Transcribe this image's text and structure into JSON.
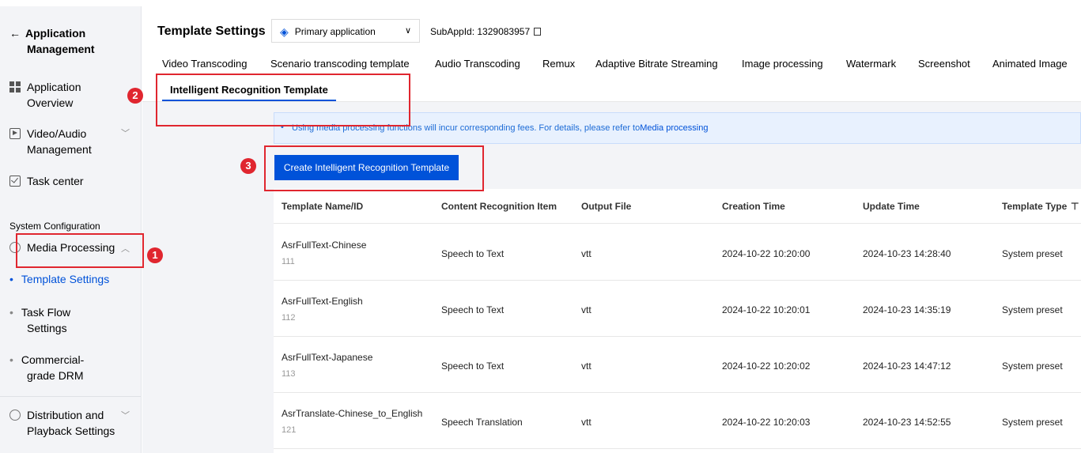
{
  "sidebar": {
    "back_label_line1": "Application",
    "back_label_line2": "Management",
    "items": [
      {
        "label1": "Application",
        "label2": "Overview",
        "icon": "grid-icon"
      },
      {
        "label1": "Video/Audio",
        "label2": "Management",
        "icon": "play-square-icon"
      },
      {
        "label1": "Task center",
        "label2": "",
        "icon": "checkbox-icon"
      }
    ],
    "section_title": "System Configuration",
    "media_processing": "Media Processing",
    "sub_items": [
      {
        "label1": "Template Settings",
        "label2": ""
      },
      {
        "label1": "Task Flow",
        "label2": "Settings"
      },
      {
        "label1": "Commercial-",
        "label2": "grade DRM"
      }
    ],
    "distribution_line1": "Distribution and",
    "distribution_line2": "Playback Settings"
  },
  "header": {
    "title": "Template Settings",
    "app_select_value": "Primary application",
    "subapp": "SubAppId: 1329083957"
  },
  "tabs": [
    "Video Transcoding",
    "Scenario transcoding template",
    "Audio Transcoding",
    "Remux",
    "Adaptive Bitrate Streaming",
    "Image processing",
    "Watermark",
    "Screenshot",
    "Animated Image"
  ],
  "active_tab": "Intelligent Recognition Template",
  "notice": {
    "text": "Using media processing functions will incur corresponding fees. For details, please refer to",
    "link": "Media processing"
  },
  "create_button": "Create Intelligent Recognition Template",
  "table": {
    "columns": [
      "Template Name/ID",
      "Content Recognition Item",
      "Output File",
      "Creation Time",
      "Update Time",
      "Template Type"
    ],
    "rows": [
      {
        "name": "AsrFullText-Chinese",
        "id": "111",
        "item": "Speech to Text",
        "output": "vtt",
        "created": "2024-10-22 10:20:00",
        "updated": "2024-10-23 14:28:40",
        "type": "System preset"
      },
      {
        "name": "AsrFullText-English",
        "id": "112",
        "item": "Speech to Text",
        "output": "vtt",
        "created": "2024-10-22 10:20:01",
        "updated": "2024-10-23 14:35:19",
        "type": "System preset"
      },
      {
        "name": "AsrFullText-Japanese",
        "id": "113",
        "item": "Speech to Text",
        "output": "vtt",
        "created": "2024-10-22 10:20:02",
        "updated": "2024-10-23 14:47:12",
        "type": "System preset"
      },
      {
        "name": "AsrTranslate-Chinese_to_English",
        "id": "121",
        "item": "Speech Translation",
        "output": "vtt",
        "created": "2024-10-22 10:20:03",
        "updated": "2024-10-23 14:52:55",
        "type": "System preset"
      }
    ]
  },
  "annotations": [
    "1",
    "2",
    "3"
  ],
  "colors": {
    "accent": "#0052d9",
    "annotation": "#e0262f"
  }
}
